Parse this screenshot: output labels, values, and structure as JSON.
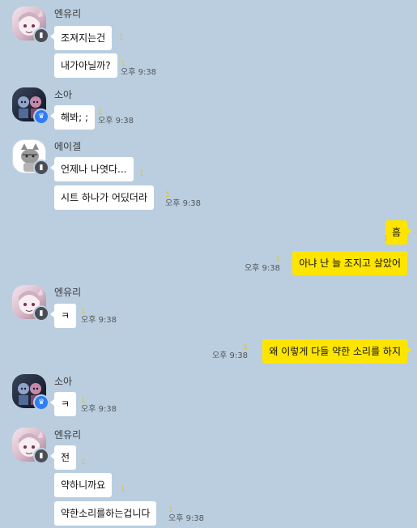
{
  "messages": [
    {
      "sender": "엔유리",
      "type": "avatar-pink",
      "lines": [
        "조져지는건",
        "내가아닐까?"
      ],
      "time": "오후 9:38",
      "unread": "1"
    },
    {
      "sender": "소아",
      "type": "avatar-dark",
      "lines": [
        "해봐; ;"
      ],
      "time": "오후 9:38",
      "unread": "1"
    },
    {
      "sender": "에이겔",
      "type": "avatar-cat",
      "lines": [
        "언제나 나엿다...",
        "시트 하나가 어딨더라"
      ],
      "time": "오후 9:38",
      "unread": "1"
    },
    {
      "sender": "me",
      "lines": [
        "흠",
        "아냐 난 늘 조지고 살았어"
      ],
      "time": "오후 9:38",
      "unread": "1"
    },
    {
      "sender": "엔유리",
      "lines": [
        "ㅋ"
      ],
      "time": "오후 9:38",
      "unread": "1"
    },
    {
      "sender": "me",
      "lines": [
        "왜 이렇게 다들 약한 소리를 하지"
      ],
      "time": "오후 9:38",
      "unread": "1"
    },
    {
      "sender": "소아",
      "lines": [
        "ㅋ"
      ],
      "time": "오후 9:38",
      "unread": "1"
    },
    {
      "sender": "엔유리",
      "lines": [
        "전",
        "약하니까요",
        "약한소리를하는겁니다"
      ],
      "time": "오후 9:38",
      "unread": "1"
    }
  ],
  "colors": {
    "background": "#bacee0",
    "my_bubble": "#fee500",
    "other_bubble": "#ffffff"
  }
}
